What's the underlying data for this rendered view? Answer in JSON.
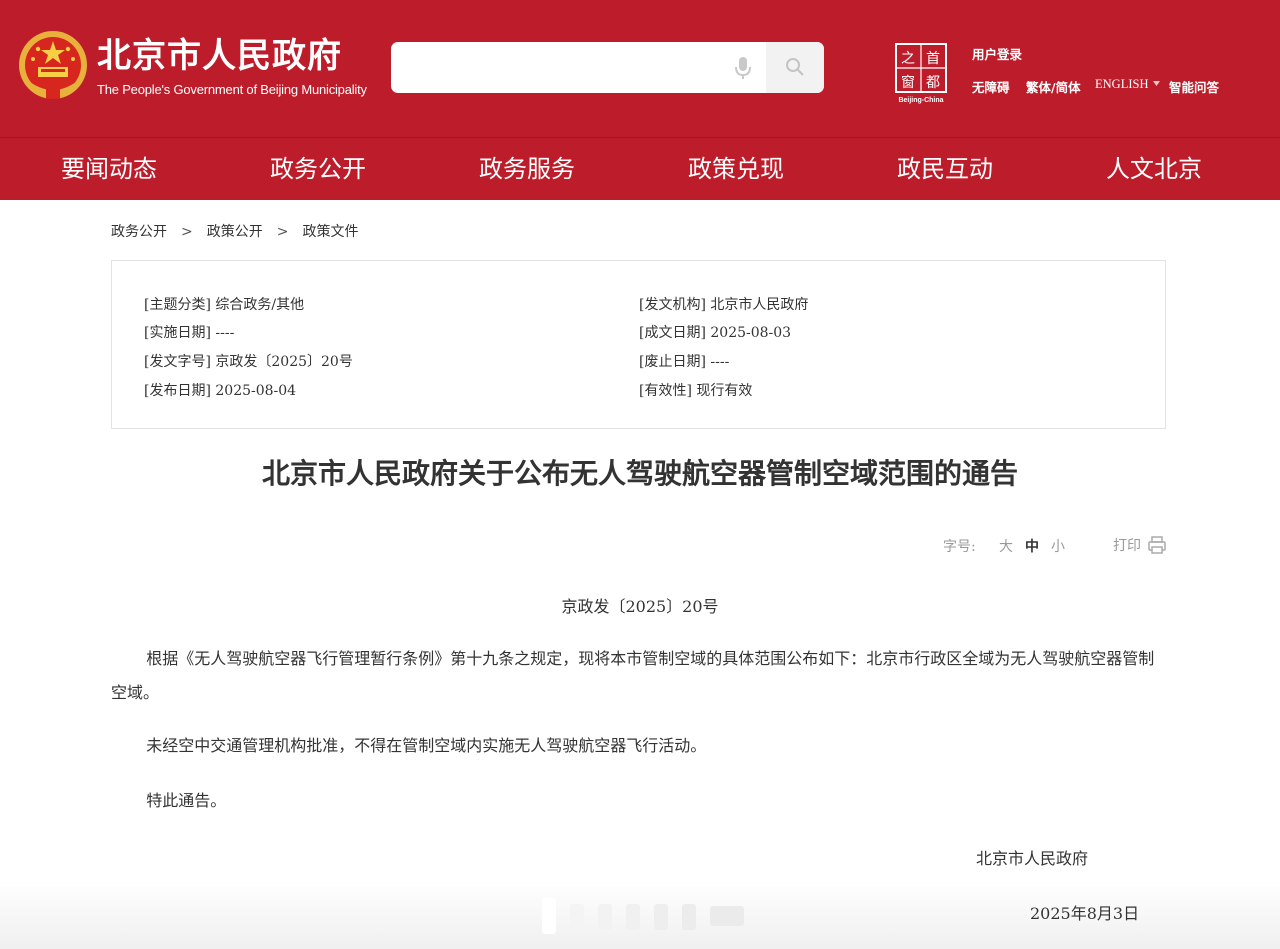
{
  "header": {
    "site_title": "北京市人民政府",
    "site_subtitle": "The People's Government of Beijing Municipality",
    "search_placeholder": "",
    "capital_logo_caption": "Beijing-China",
    "capital_logo_chars": [
      "首",
      "都",
      "之",
      "窗"
    ],
    "utility": {
      "login": "用户登录",
      "accessibility": "无障碍",
      "traditional_simplified": "繁体/简体",
      "english": "ENGLISH",
      "smart_qa": "智能问答"
    }
  },
  "nav": {
    "items": [
      "要闻动态",
      "政务公开",
      "政务服务",
      "政策兑现",
      "政民互动",
      "人文北京"
    ]
  },
  "breadcrumb": [
    "政务公开",
    "政策公开",
    "政策文件"
  ],
  "breadcrumb_separator": ">",
  "meta": {
    "topic": "[主题分类] 综合政务/其他",
    "effective_date": "[实施日期] ----",
    "doc_number": "[发文字号] 京政发〔2025〕20号",
    "publish_date": "[发布日期] 2025-08-04",
    "issuer": "[发文机构] 北京市人民政府",
    "written_date": "[成文日期] 2025-08-03",
    "expiry_date": "[废止日期] ----",
    "validity": "[有效性] 现行有效"
  },
  "article": {
    "title": "北京市人民政府关于公布无人驾驶航空器管制空域范围的通告",
    "font_size_label": "字号:",
    "font_sizes": [
      "大",
      "中",
      "小"
    ],
    "font_size_selected": "中",
    "print_label": "打印",
    "doc_number": "京政发〔2025〕20号",
    "paragraphs": [
      "根据《无人驾驶航空器飞行管理暂行条例》第十九条之规定，现将本市管制空域的具体范围公布如下：北京市行政区全域为无人驾驶航空器管制空域。",
      "未经空中交通管理机构批准，不得在管制空域内实施无人驾驶航空器飞行活动。",
      "特此通告。"
    ],
    "signature_org": "北京市人民政府",
    "signature_date": "2025年8月3日"
  },
  "colors": {
    "brand_red": "#bd1d2b",
    "text": "#333333",
    "muted": "#999999"
  },
  "icons": [
    "national-emblem-icon",
    "microphone-icon",
    "search-icon",
    "capital-window-logo-icon",
    "dropdown-caret-icon",
    "printer-icon"
  ]
}
